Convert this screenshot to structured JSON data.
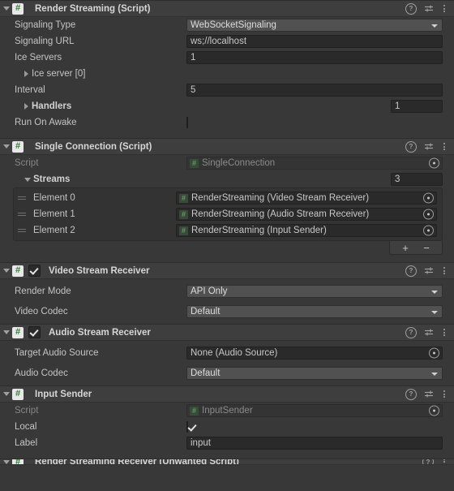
{
  "header_icons": {
    "help": "?",
    "help_name": "help-icon",
    "preset": "preset-icon",
    "menu": "more-menu-icon"
  },
  "colors": {
    "panel_bg": "#383838",
    "header_bg": "#3e3e3e",
    "field_bg": "#2a2a2a",
    "dropdown_bg": "#515151",
    "script_green": "#2f7d32",
    "text": "#c4c4c4"
  },
  "components": [
    {
      "title": "Render Streaming (Script)",
      "icon": "script-icon",
      "has_enable_toggle": false,
      "expanded": true,
      "rows": [
        {
          "label": "Signaling Type",
          "type": "dropdown",
          "value": "WebSocketSignaling"
        },
        {
          "label": "Signaling URL",
          "type": "text",
          "value": "ws;//localhost"
        },
        {
          "label": "Ice Servers",
          "type": "text",
          "value": "1"
        },
        {
          "label": "Ice server [0]",
          "type": "foldout",
          "value": ""
        },
        {
          "label": "Interval",
          "type": "text",
          "value": "5"
        },
        {
          "label": "Handlers",
          "type": "array_size",
          "value": "1"
        },
        {
          "label": "Run On Awake",
          "type": "checkbox",
          "value": "unchecked"
        }
      ]
    },
    {
      "title": "Single Connection (Script)",
      "icon": "script-icon",
      "has_enable_toggle": false,
      "expanded": true,
      "rows": [
        {
          "label": "Script",
          "type": "object_disabled",
          "value": "SingleConnection"
        },
        {
          "label": "Streams",
          "type": "list_header",
          "value": "3"
        }
      ],
      "list": {
        "elements": [
          {
            "label": "Element 0",
            "value": "RenderStreaming (Video Stream Receiver)"
          },
          {
            "label": "Element 1",
            "value": "RenderStreaming (Audio Stream Receiver)"
          },
          {
            "label": "Element 2",
            "value": "RenderStreaming (Input Sender)"
          }
        ],
        "add_label": "+",
        "remove_label": "−"
      }
    },
    {
      "title": "Video Stream Receiver",
      "icon": "script-icon",
      "has_enable_toggle": true,
      "enabled": true,
      "expanded": true,
      "rows": [
        {
          "label": "Render Mode",
          "type": "dropdown",
          "value": "API Only"
        },
        {
          "label": "Video Codec",
          "type": "dropdown",
          "value": "Default"
        }
      ]
    },
    {
      "title": "Audio Stream Receiver",
      "icon": "script-icon",
      "has_enable_toggle": true,
      "enabled": true,
      "expanded": true,
      "rows": [
        {
          "label": "Target Audio Source",
          "type": "object",
          "value": "None (Audio Source)"
        },
        {
          "label": "Audio Codec",
          "type": "dropdown",
          "value": "Default"
        }
      ]
    },
    {
      "title": "Input Sender",
      "icon": "script-icon",
      "has_enable_toggle": false,
      "expanded": true,
      "rows": [
        {
          "label": "Script",
          "type": "object_disabled",
          "value": "InputSender"
        },
        {
          "label": "Local",
          "type": "checkbox",
          "value": "checked"
        },
        {
          "label": "Label",
          "type": "text",
          "value": "input"
        }
      ]
    }
  ],
  "clipped_component": {
    "title": "Render Streaming Receiver (Unwanted Script)"
  }
}
